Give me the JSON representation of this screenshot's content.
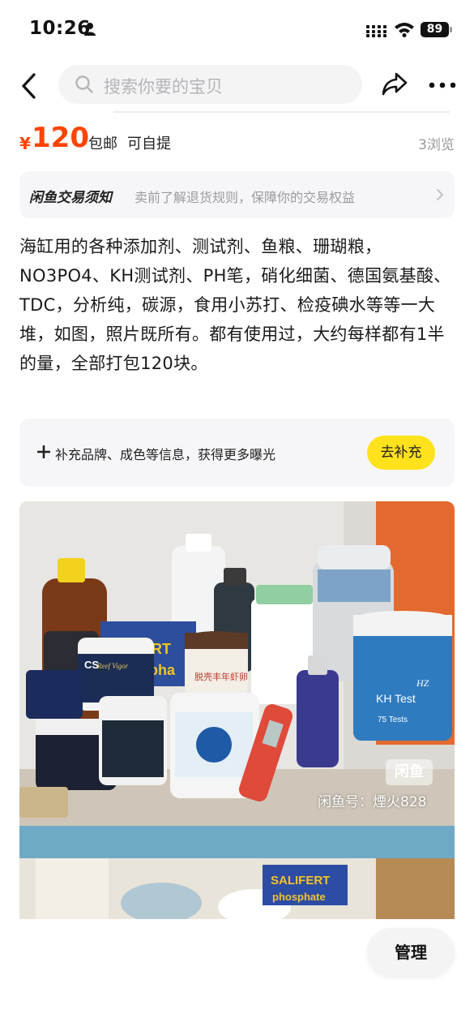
{
  "status_bar": {
    "time": "10:26",
    "battery": "89",
    "icons": [
      "person-icon",
      "signal-icon",
      "wifi-icon",
      "battery-icon"
    ]
  },
  "nav": {
    "search_placeholder": "搜索你要的宝贝",
    "icons": [
      "back-arrow-icon",
      "search-icon",
      "share-icon",
      "more-icon"
    ]
  },
  "item": {
    "currency": "¥",
    "price": "120",
    "tags": [
      "包邮",
      "可自提"
    ],
    "views": "3浏览",
    "description": "海缸用的各种添加剂、测试剂、鱼粮、珊瑚粮，NO3PO4、KH测试剂、PH笔，硝化细菌、德国氨基酸、TDC，分析纯，碳源，食用小苏打、检疫碘水等等一大堆，如图，照片既所有。都有使用过，大约每样都有1半的量，全部打包120块。"
  },
  "notice": {
    "title": "闲鱼交易须知",
    "text": "卖前了解退货规则，保障你的交易权益"
  },
  "supplement": {
    "text": "补充品牌、成色等信息，获得更多曝光",
    "button": "去补充"
  },
  "photo": {
    "watermark_logo": "闲鱼",
    "watermark_text": "闲鱼号：煙火828",
    "labels": {
      "jar_left_brand": "CS",
      "jar_left_name": "Reef Vigor",
      "tub_brown": "脱壳丰年虾卵",
      "kh_test": "KH Test",
      "kh_tests_count": "75 Tests",
      "kh_hz": "HZ",
      "box_fert": "FERT",
      "box_pha": "pha",
      "salifert": "SALIFERT",
      "phosphate": "phosphate"
    }
  },
  "actions": {
    "manage": "管理"
  },
  "colors": {
    "price": "#ff4400",
    "accent_button": "#ffe11c",
    "panel_bg": "#f6f6f8",
    "muted_text": "#9b9b9f"
  }
}
